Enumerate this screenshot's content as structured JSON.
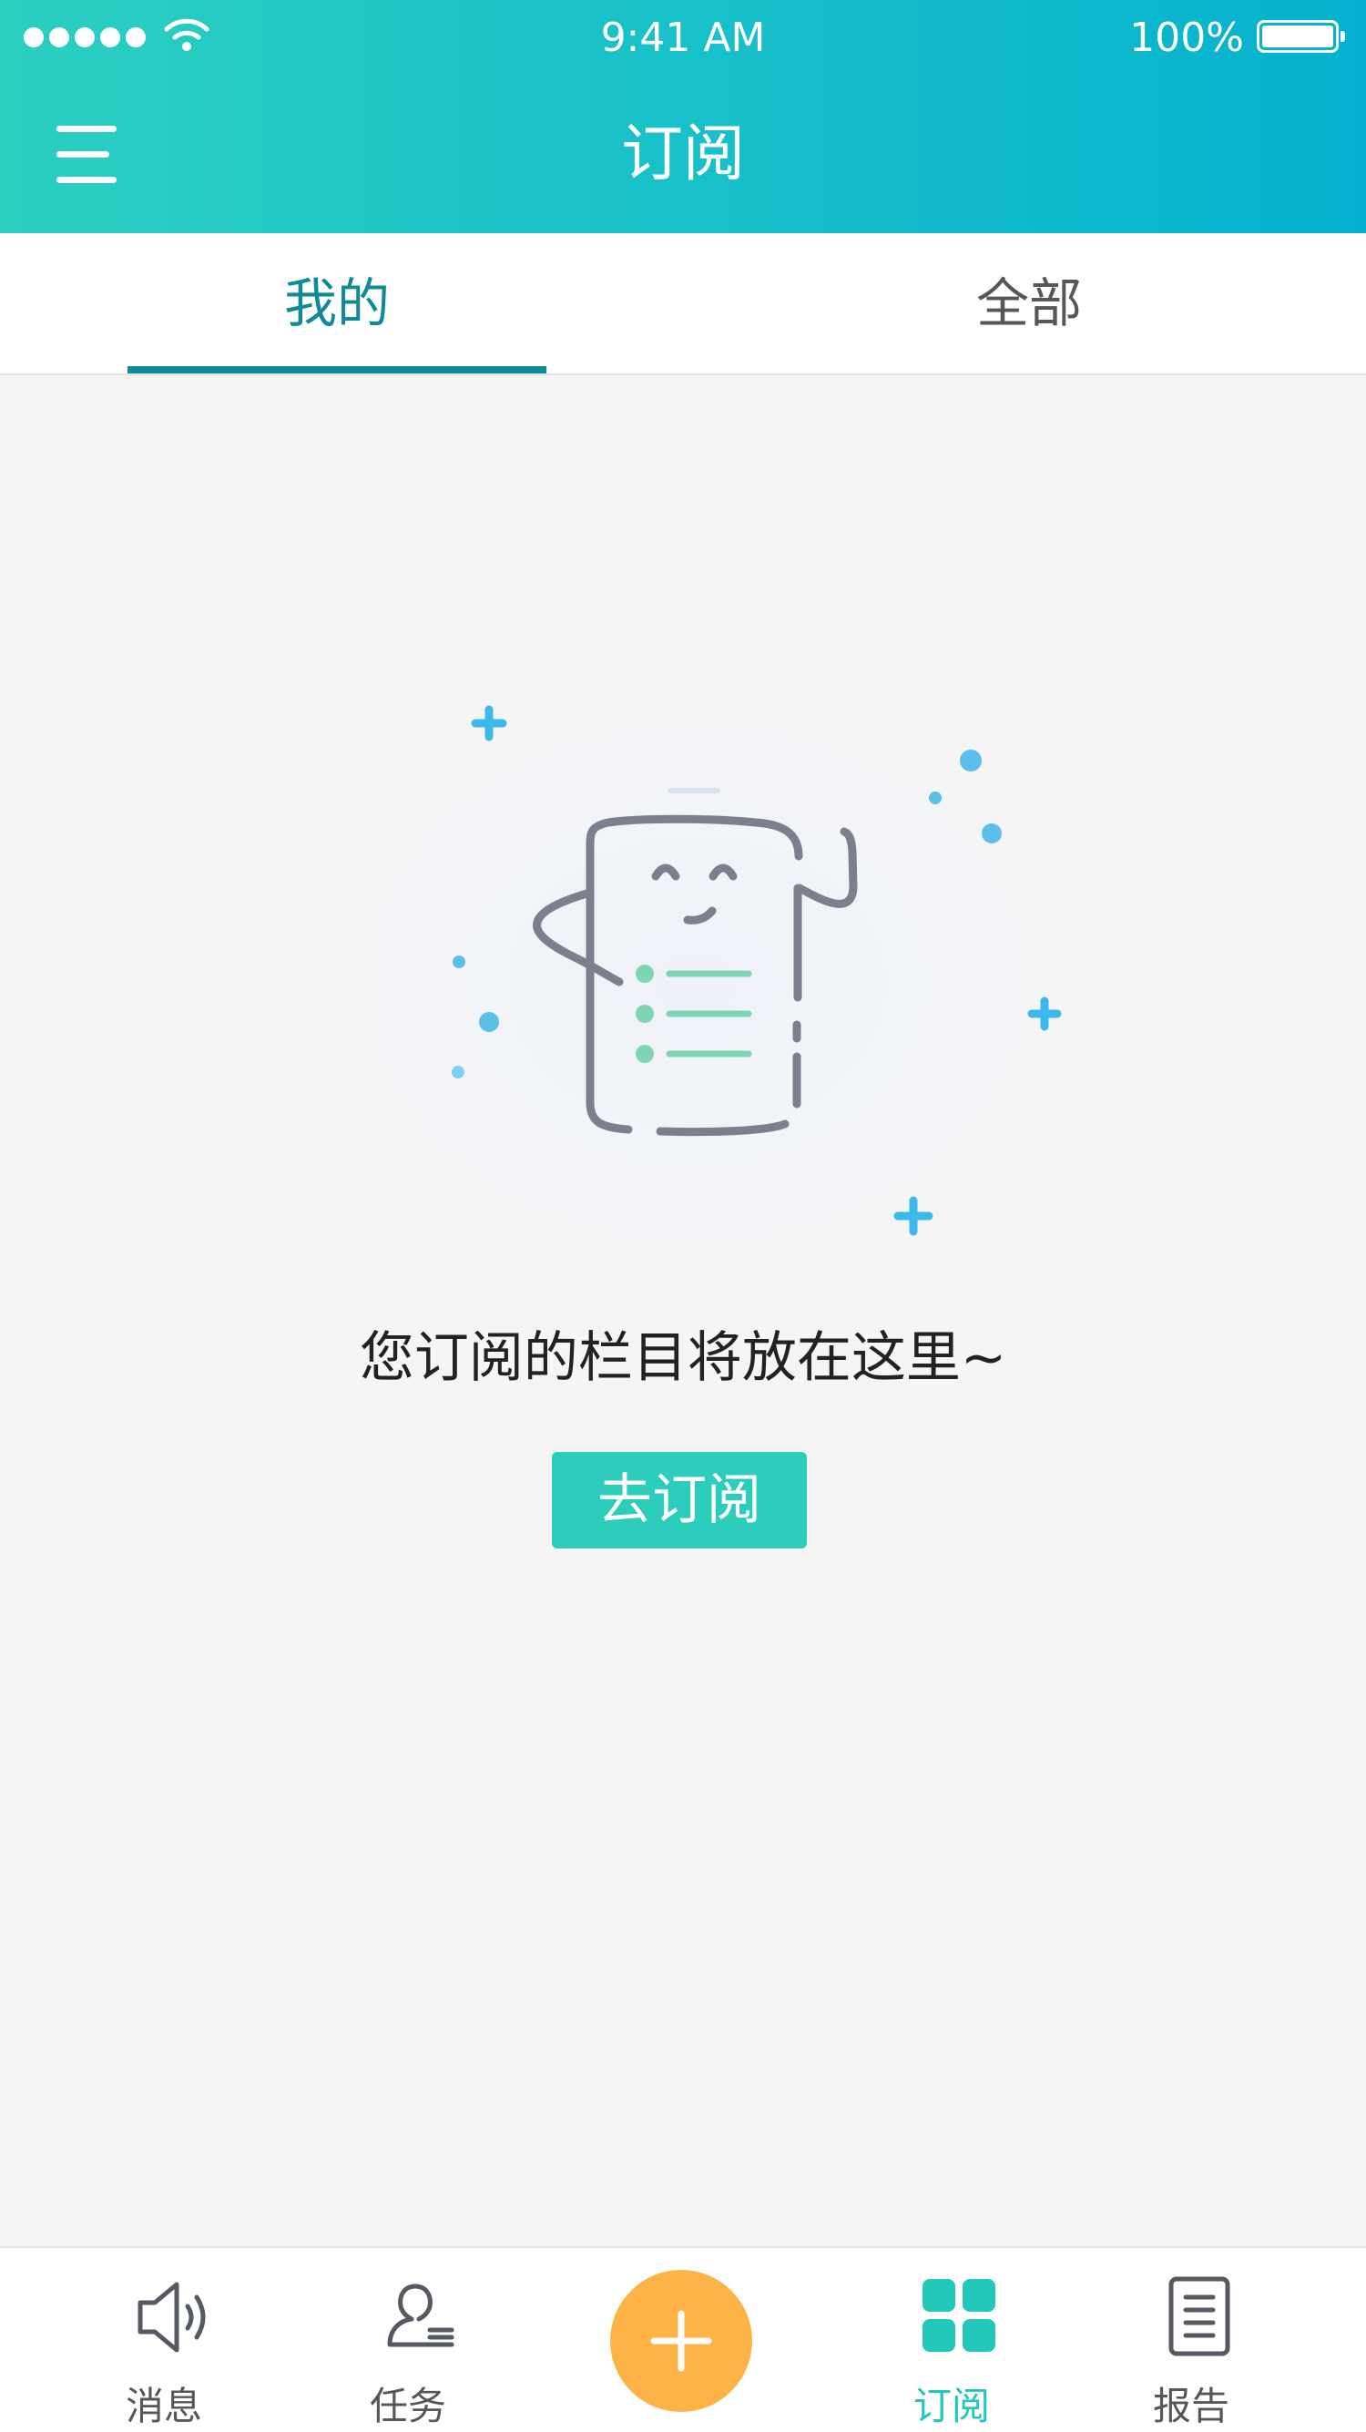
{
  "status_bar": {
    "time": "9:41 AM",
    "battery": "100%"
  },
  "header": {
    "title": "订阅",
    "menu_icon": "hamburger-menu-icon"
  },
  "tabs": [
    {
      "label": "我的",
      "active": true
    },
    {
      "label": "全部",
      "active": false
    }
  ],
  "empty_state": {
    "illustration": "document-mascot-illustration",
    "message": "您订阅的栏目将放在这里~",
    "button_label": "去订阅"
  },
  "tab_bar": {
    "items": [
      {
        "label": "消息",
        "icon": "speaker-icon",
        "active": false
      },
      {
        "label": "任务",
        "icon": "user-task-icon",
        "active": false
      },
      {
        "label": "",
        "icon": "plus-icon",
        "active": false
      },
      {
        "label": "订阅",
        "icon": "grid-icon",
        "active": true
      },
      {
        "label": "报告",
        "icon": "report-document-icon",
        "active": false
      }
    ]
  },
  "colors": {
    "header_gradient_start": "#2ccfc0",
    "header_gradient_end": "#06b1cf",
    "tab_active": "#0f8a96",
    "button_bg": "#2ccdbb",
    "fab_bg": "#fdb345",
    "tab_bar_active": "#23c8ba"
  }
}
